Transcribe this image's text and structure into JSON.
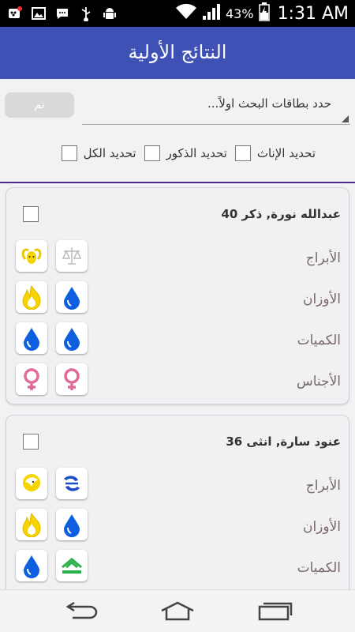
{
  "status_bar": {
    "battery_percent": "43%",
    "time": "1:31 AM",
    "icons": [
      "bbm-icon",
      "image-icon",
      "chat-icon",
      "usb-icon",
      "android-debug-icon",
      "wifi-icon",
      "signal-icon",
      "battery-charging-icon"
    ]
  },
  "app_bar": {
    "title": "النتائج الأولية"
  },
  "controls": {
    "ok_button": "تم",
    "search_select": "حدد بطاقات البحث اولاً...",
    "filters": {
      "select_females": "تحديد الإناث",
      "select_males": "تحديد الذكور",
      "select_all": "تحديد الكل"
    }
  },
  "cards": [
    {
      "title": "عبدالله نورة, ذكر 40",
      "rows": [
        {
          "label": "الأبراج",
          "icon_a": "libra-icon",
          "icon_b": "aries-icon"
        },
        {
          "label": "الأوزان",
          "icon_a": "water-icon",
          "icon_b": "fire-icon"
        },
        {
          "label": "الكميات",
          "icon_a": "water-icon",
          "icon_b": "water-icon"
        },
        {
          "label": "الأجناس",
          "icon_a": "female-icon",
          "icon_b": "female-icon"
        }
      ]
    },
    {
      "title": "عنود سارة, انثى 36",
      "rows": [
        {
          "label": "الأبراج",
          "icon_a": "pisces-icon",
          "icon_b": "leo-icon"
        },
        {
          "label": "الأوزان",
          "icon_a": "water-icon",
          "icon_b": "fire-icon"
        },
        {
          "label": "الكميات",
          "icon_a": "earth-icon",
          "icon_b": "water-icon"
        }
      ]
    }
  ],
  "colors": {
    "app_bar": "#3f51b5",
    "divider": "#4a2a8f",
    "water": "#0d5fe0",
    "fire": "#f5d400",
    "female": "#e06a9a",
    "earth": "#2bb24c"
  },
  "navigation": [
    "back-icon",
    "home-icon",
    "recents-icon"
  ]
}
